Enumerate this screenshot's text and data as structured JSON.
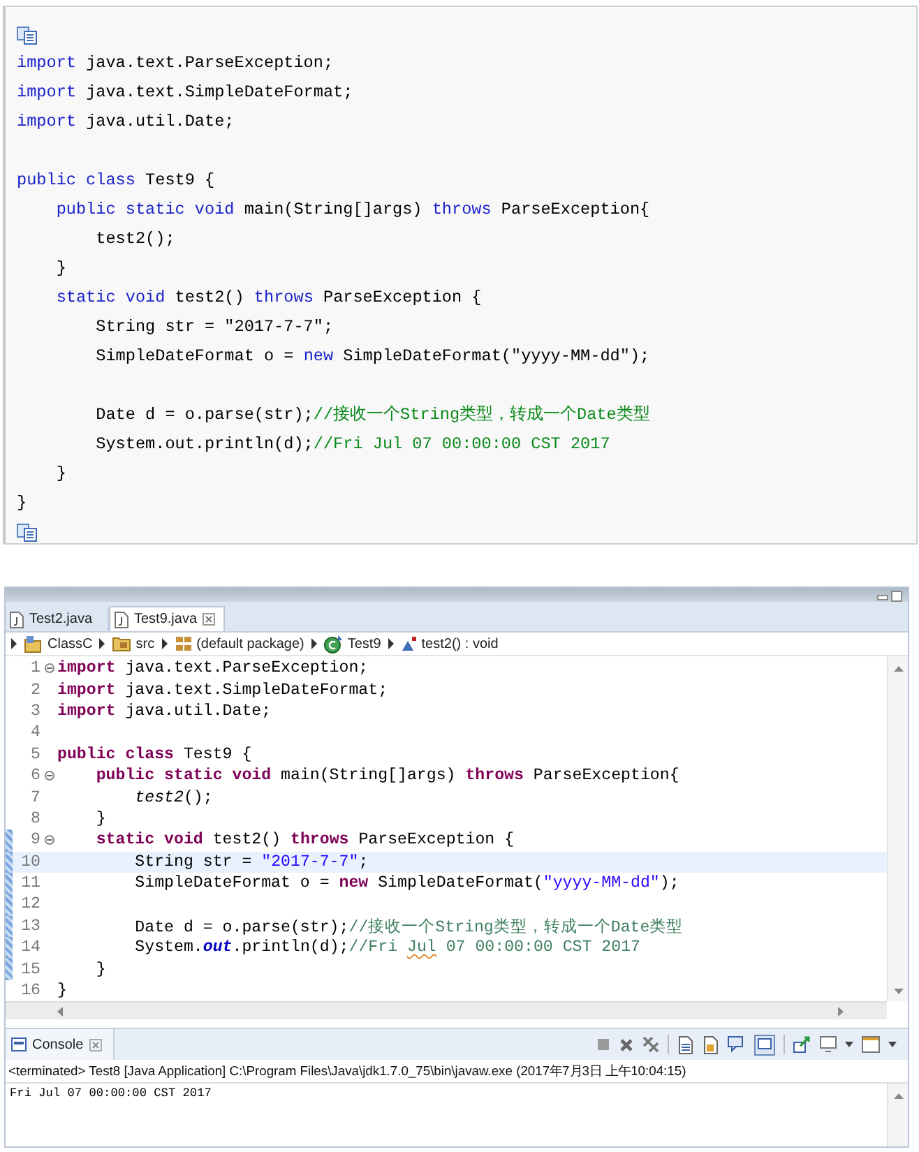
{
  "snippet": {
    "lines": [
      {
        "tokens": [
          {
            "kind": "kw",
            "text": "import"
          },
          {
            "kind": "p",
            "text": " java.text.ParseException;"
          }
        ]
      },
      {
        "tokens": [
          {
            "kind": "kw",
            "text": "import"
          },
          {
            "kind": "p",
            "text": " java.text.SimpleDateFormat;"
          }
        ]
      },
      {
        "tokens": [
          {
            "kind": "kw",
            "text": "import"
          },
          {
            "kind": "p",
            "text": " java.util.Date;"
          }
        ]
      },
      {
        "blank": true
      },
      {
        "tokens": [
          {
            "kind": "kw",
            "text": "public class"
          },
          {
            "kind": "p",
            "text": " Test9 {"
          }
        ]
      },
      {
        "tokens": [
          {
            "kind": "kw",
            "text": "    public static void"
          },
          {
            "kind": "p",
            "text": " main(String[]args) "
          },
          {
            "kind": "kw",
            "text": "throws"
          },
          {
            "kind": "p",
            "text": " ParseException{"
          }
        ]
      },
      {
        "tokens": [
          {
            "kind": "p",
            "text": "        test2();"
          }
        ]
      },
      {
        "tokens": [
          {
            "kind": "p",
            "text": "    }"
          }
        ]
      },
      {
        "tokens": [
          {
            "kind": "kw",
            "text": "    static void"
          },
          {
            "kind": "p",
            "text": " test2() "
          },
          {
            "kind": "kw",
            "text": "throws"
          },
          {
            "kind": "p",
            "text": " ParseException {"
          }
        ]
      },
      {
        "tokens": [
          {
            "kind": "p",
            "text": "        String str = \"2017-7-7\";"
          }
        ]
      },
      {
        "tokens": [
          {
            "kind": "p",
            "text": "        SimpleDateFormat o = "
          },
          {
            "kind": "kw",
            "text": "new"
          },
          {
            "kind": "p",
            "text": " SimpleDateFormat(\"yyyy-MM-dd\");"
          }
        ]
      },
      {
        "blank": true
      },
      {
        "tokens": [
          {
            "kind": "p",
            "text": "        Date d = o.parse(str);"
          },
          {
            "kind": "cmt",
            "text": "//接收一个String类型，转成一个Date类型"
          }
        ]
      },
      {
        "tokens": [
          {
            "kind": "p",
            "text": "        System.out.println(d);"
          },
          {
            "kind": "cmt",
            "text": "//Fri Jul 07 00:00:00 CST 2017"
          }
        ]
      },
      {
        "tokens": [
          {
            "kind": "p",
            "text": "    }"
          }
        ]
      },
      {
        "tokens": [
          {
            "kind": "p",
            "text": "}"
          }
        ]
      }
    ]
  },
  "ide": {
    "tabs": [
      {
        "label": "Test2.java",
        "selected": false
      },
      {
        "label": "Test9.java",
        "selected": true
      }
    ],
    "breadcrumb": [
      {
        "label": "ClassC",
        "kind": "project"
      },
      {
        "label": "src",
        "kind": "source"
      },
      {
        "label": "(default package)",
        "kind": "package"
      },
      {
        "label": "Test9",
        "kind": "class"
      },
      {
        "label": "test2() : void",
        "kind": "method"
      }
    ],
    "lines": [
      {
        "number": "1",
        "fold": true,
        "changed": false,
        "current": false,
        "tokens": [
          {
            "kind": "kw",
            "text": "import"
          },
          {
            "kind": "p",
            "text": " java.text.ParseException;"
          }
        ]
      },
      {
        "number": "2",
        "fold": false,
        "changed": false,
        "current": false,
        "tokens": [
          {
            "kind": "kw",
            "text": "import"
          },
          {
            "kind": "p",
            "text": " java.text.SimpleDateFormat;"
          }
        ]
      },
      {
        "number": "3",
        "fold": false,
        "changed": false,
        "current": false,
        "tokens": [
          {
            "kind": "kw",
            "text": "import"
          },
          {
            "kind": "p",
            "text": " java.util.Date;"
          }
        ]
      },
      {
        "number": "4",
        "fold": false,
        "changed": false,
        "current": false
      },
      {
        "number": "5",
        "fold": false,
        "changed": false,
        "current": false,
        "tokens": [
          {
            "kind": "kw",
            "text": "public class"
          },
          {
            "kind": "p",
            "text": " Test9 {"
          }
        ]
      },
      {
        "number": "6",
        "fold": true,
        "changed": false,
        "current": false,
        "tokens": [
          {
            "kind": "kw",
            "text": "    public static void"
          },
          {
            "kind": "p",
            "text": " main(String[]args) "
          },
          {
            "kind": "kw",
            "text": "throws"
          },
          {
            "kind": "p",
            "text": " ParseException{"
          }
        ]
      },
      {
        "number": "7",
        "fold": false,
        "changed": false,
        "current": false,
        "tokens": [
          {
            "kind": "call",
            "text": "        test2"
          },
          {
            "kind": "p",
            "text": "();"
          }
        ]
      },
      {
        "number": "8",
        "fold": false,
        "changed": false,
        "current": false,
        "tokens": [
          {
            "kind": "p",
            "text": "    }"
          }
        ]
      },
      {
        "number": "9",
        "fold": true,
        "changed": true,
        "current": false,
        "tokens": [
          {
            "kind": "kw",
            "text": "    static void"
          },
          {
            "kind": "p",
            "text": " test2() "
          },
          {
            "kind": "kw",
            "text": "throws"
          },
          {
            "kind": "p",
            "text": " ParseException {"
          }
        ]
      },
      {
        "number": "10",
        "fold": false,
        "changed": true,
        "current": true,
        "tokens": [
          {
            "kind": "p",
            "text": "        String str = "
          },
          {
            "kind": "str",
            "text": "\"2017-7-7\""
          },
          {
            "kind": "p",
            "text": ";"
          }
        ]
      },
      {
        "number": "11",
        "fold": false,
        "changed": true,
        "current": false,
        "tokens": [
          {
            "kind": "p",
            "text": "        SimpleDateFormat o = "
          },
          {
            "kind": "kw",
            "text": "new"
          },
          {
            "kind": "p",
            "text": " SimpleDateFormat("
          },
          {
            "kind": "str",
            "text": "\"yyyy-MM-dd\""
          },
          {
            "kind": "p",
            "text": ");"
          }
        ]
      },
      {
        "number": "12",
        "fold": false,
        "changed": true,
        "current": false
      },
      {
        "number": "13",
        "fold": false,
        "changed": true,
        "current": false,
        "tokens": [
          {
            "kind": "p",
            "text": "        Date d = o.parse(str);"
          },
          {
            "kind": "cmt",
            "text": "//接收一个String类型，转成一个Date类型"
          }
        ]
      },
      {
        "number": "14",
        "fold": false,
        "changed": true,
        "current": false,
        "tokens": [
          {
            "kind": "p",
            "text": "        System."
          },
          {
            "kind": "field",
            "text": "out"
          },
          {
            "kind": "p",
            "text": ".println(d);"
          },
          {
            "kind": "cmt",
            "text": "//Fri "
          },
          {
            "kind": "spell",
            "text": "Jul"
          },
          {
            "kind": "cmt",
            "text": " 07 00:00:00 CST 2017"
          }
        ]
      },
      {
        "number": "15",
        "fold": false,
        "changed": true,
        "current": false,
        "tokens": [
          {
            "kind": "p",
            "text": "    }"
          }
        ]
      },
      {
        "number": "16",
        "fold": false,
        "changed": false,
        "current": false,
        "tokens": [
          {
            "kind": "p",
            "text": "}"
          }
        ]
      }
    ],
    "console": {
      "tab": "Console",
      "status": "<terminated> Test8 [Java Application] C:\\Program Files\\Java\\jdk1.7.0_75\\bin\\javaw.exe (2017年7月3日 上午10:04:15)",
      "output": [
        "Fri Jul 07 00:00:00 CST 2017"
      ]
    }
  }
}
